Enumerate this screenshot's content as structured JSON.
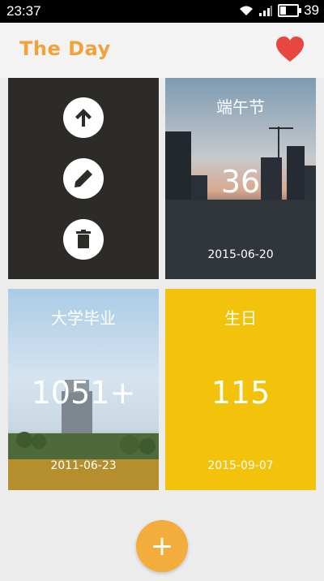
{
  "status_bar": {
    "time": "23:37",
    "battery": "39",
    "battery_level": 0.39
  },
  "header": {
    "title": "The Day",
    "favorite_icon": "heart-icon",
    "accent_color": "#f2a23b",
    "heart_color": "#e8473f"
  },
  "cards": [
    {
      "actions": [
        "upload-icon",
        "edit-icon",
        "delete-icon"
      ]
    },
    {
      "title": "端午节",
      "count": "36",
      "date": "2015-06-20"
    },
    {
      "title": "大学毕业",
      "count": "1051+",
      "date": "2011-06-23"
    },
    {
      "title": "生日",
      "count": "115",
      "date": "2015-09-07",
      "color": "#f3c20a"
    }
  ],
  "fab": {
    "label": "+",
    "color": "#f3ad3d"
  }
}
